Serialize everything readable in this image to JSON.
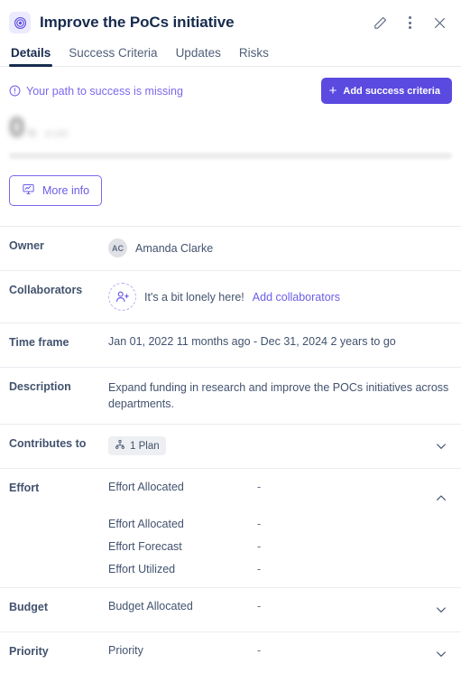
{
  "header": {
    "title": "Improve the PoCs initiative",
    "icon": "target-icon",
    "actions": [
      {
        "name": "edit-icon",
        "label": "Edit"
      },
      {
        "name": "more-options-icon",
        "label": "More options"
      },
      {
        "name": "close-icon",
        "label": "Close"
      }
    ]
  },
  "tabs": [
    {
      "label": "Details",
      "active": true
    },
    {
      "label": "Success Criteria",
      "active": false
    },
    {
      "label": "Updates",
      "active": false
    },
    {
      "label": "Risks",
      "active": false
    }
  ],
  "alert": {
    "icon": "info-circle-icon",
    "text": "Your path to success is missing"
  },
  "primary_button": {
    "label": "Add success criteria",
    "icon": "plus-icon"
  },
  "progress": {
    "percent_value": "0",
    "percent_symbol": "%",
    "of_label": "of 100",
    "bar_fill_percent": 0
  },
  "more_info_button": {
    "label": "More info",
    "icon": "presentation-chart-icon"
  },
  "details": {
    "owner": {
      "label": "Owner",
      "avatar_initials": "AC",
      "name": "Amanda Clarke"
    },
    "collaborators": {
      "label": "Collaborators",
      "icon": "add-person-icon",
      "empty_text": "It's a bit lonely here!",
      "link_text": "Add collaborators"
    },
    "time_frame": {
      "label": "Time frame",
      "value": "Jan 01, 2022 11 months ago - Dec 31, 2024 2 years to go"
    },
    "description": {
      "label": "Description",
      "value": "Expand funding in research and improve the POCs initiatives across departments."
    },
    "contributes_to": {
      "label": "Contributes to",
      "chip_icon": "hierarchy-icon",
      "chip_label": "1 Plan",
      "chevron": "chevron-down-icon"
    },
    "effort": {
      "label": "Effort",
      "summary_name": "Effort Allocated",
      "summary_value": "-",
      "chevron": "chevron-up-icon",
      "sub_rows": [
        {
          "name": "Effort Allocated",
          "value": "-"
        },
        {
          "name": "Effort Forecast",
          "value": "-"
        },
        {
          "name": "Effort Utilized",
          "value": "-"
        }
      ]
    },
    "budget": {
      "label": "Budget",
      "summary_name": "Budget Allocated",
      "summary_value": "-",
      "chevron": "chevron-down-icon"
    },
    "priority": {
      "label": "Priority",
      "summary_name": "Priority",
      "summary_value": "-",
      "chevron": "chevron-down-icon"
    }
  },
  "colors": {
    "accent": "#5b4ae0",
    "accent_light": "#7b68ee",
    "text_dark": "#172b4d",
    "text_body": "#42526e",
    "border": "#ebecf0"
  }
}
